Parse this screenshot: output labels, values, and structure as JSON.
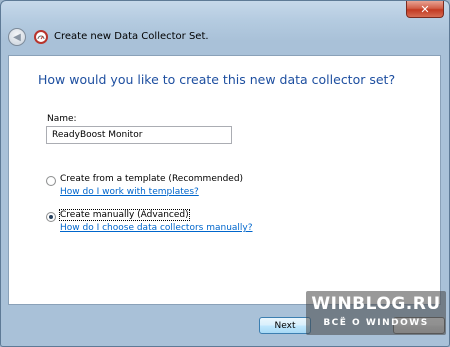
{
  "window": {
    "close_glyph": "✕",
    "title": "Create new Data Collector Set."
  },
  "nav": {
    "back_glyph": "◀"
  },
  "main": {
    "heading": "How would you like to create this new data collector set?",
    "name_label": "Name:",
    "name_value": "ReadyBoost Monitor",
    "options": [
      {
        "label": "Create from a template (Recommended)",
        "link": "How do I work with templates?",
        "checked": false
      },
      {
        "label": "Create manually (Advanced)",
        "link": "How do I choose data collectors manually?",
        "checked": true
      }
    ]
  },
  "footer": {
    "next_label": "Next"
  },
  "watermark": {
    "main": "WINBLOG.RU",
    "sub": "ВСЁ О WINDOWS"
  },
  "icons": {
    "back": "back-arrow-icon",
    "wizard": "data-collector-icon",
    "close": "close-icon"
  },
  "colors": {
    "heading": "#1e4fa0",
    "link": "#0066cc",
    "close_button": "#c23a22"
  }
}
